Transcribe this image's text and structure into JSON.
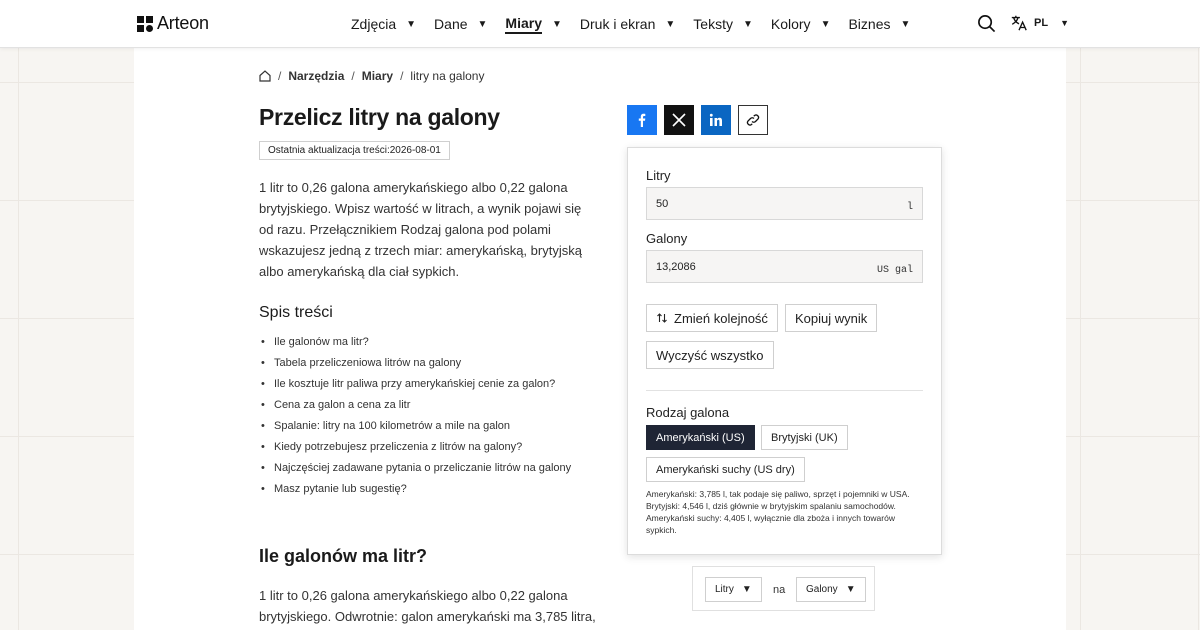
{
  "header": {
    "logo": "Arteon",
    "nav": [
      {
        "label": "Zdjęcia",
        "active": false
      },
      {
        "label": "Dane",
        "active": false
      },
      {
        "label": "Miary",
        "active": true
      },
      {
        "label": "Druk i ekran",
        "active": false
      },
      {
        "label": "Teksty",
        "active": false
      },
      {
        "label": "Kolory",
        "active": false
      },
      {
        "label": "Biznes",
        "active": false
      }
    ],
    "language": "PL"
  },
  "breadcrumb": {
    "items": [
      "Narzędzia",
      "Miary",
      "litry na galony"
    ]
  },
  "article": {
    "title": "Przelicz litry na galony",
    "update_badge": "Ostatnia aktualizacja treści:2026-08-01",
    "intro": "1 litr to 0,26 galona amerykańskiego albo 0,22 galona brytyjskiego. Wpisz wartość w litrach, a wynik pojawi się od razu. Przełącznikiem Rodzaj galona pod polami wskazujesz jedną z trzech miar: amerykańską, brytyjską albo amerykańską dla ciał sypkich.",
    "toc_title": "Spis treści",
    "toc": [
      "Ile galonów ma litr?",
      "Tabela przeliczeniowa litrów na galony",
      "Ile kosztuje litr paliwa przy amerykańskiej cenie za galon?",
      "Cena za galon a cena za litr",
      "Spalanie: litry na 100 kilometrów a mile na galon",
      "Kiedy potrzebujesz przeliczenia z litrów na galony?",
      "Najczęściej zadawane pytania o przeliczanie litrów na galony",
      "Masz pytanie lub sugestię?"
    ],
    "section_title": "Ile galonów ma litr?",
    "section_text": "1 litr to 0,26 galona amerykańskiego albo 0,22 galona brytyjskiego. Odwrotnie: galon amerykański ma 3,785 litra,"
  },
  "converter": {
    "liters_label": "Litry",
    "liters_value": "50",
    "liters_unit": "l",
    "gallons_label": "Galony",
    "gallons_value": "13,2086",
    "gallons_unit": "US gal",
    "swap_button": "Zmień kolejność",
    "copy_button": "Kopiuj wynik",
    "clear_button": "Wyczyść wszystko",
    "gallon_type_label": "Rodzaj galona",
    "options": [
      "Amerykański (US)",
      "Brytyjski (UK)",
      "Amerykański suchy (US dry)"
    ],
    "selected_option": "Amerykański (US)",
    "note": "Amerykański: 3,785 l, tak podaje się paliwo, sprzęt i pojemniki w USA. Brytyjski: 4,546 l, dziś głównie w brytyjskim spalaniu samochodów. Amerykański suchy: 4,405 l, wyłącznie dla zboża i innych towarów sypkich."
  },
  "unit_selector": {
    "from": "Litry",
    "connector": "na",
    "to": "Galony"
  },
  "colors": {
    "accent_dark": "#1f2535",
    "facebook": "#1877f2",
    "linkedin": "#0a66c2",
    "x": "#111111"
  }
}
